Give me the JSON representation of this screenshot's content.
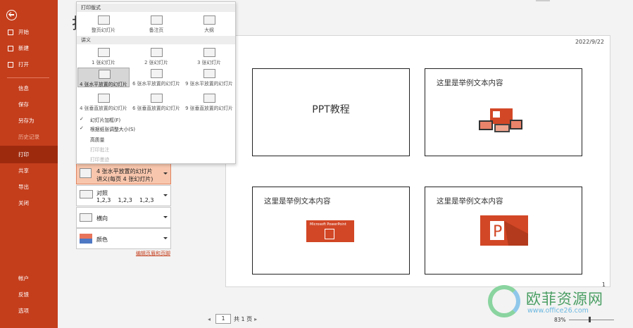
{
  "nav": {
    "items": [
      {
        "label": "开始",
        "icon": "home-icon"
      },
      {
        "label": "新建",
        "icon": "new-file-icon"
      },
      {
        "label": "打开",
        "icon": "folder-open-icon"
      },
      {
        "label": "信息"
      },
      {
        "label": "保存"
      },
      {
        "label": "另存为"
      },
      {
        "label": "历史记录"
      },
      {
        "label": "打印"
      },
      {
        "label": "共享"
      },
      {
        "label": "导出"
      },
      {
        "label": "关闭"
      },
      {
        "label": "帐户"
      },
      {
        "label": "反馈"
      },
      {
        "label": "选项"
      }
    ]
  },
  "title_glyph": "打",
  "dropdown": {
    "section_print_layout": "打印版式",
    "layouts": [
      "整页幻灯片",
      "备注页",
      "大纲"
    ],
    "section_handouts": "讲义",
    "handouts": [
      "1 张幻灯片",
      "2 张幻灯片",
      "3 张幻灯片",
      "4 张水平放置的幻灯片",
      "6 张水平放置的幻灯片",
      "9 张水平放置的幻灯片",
      "4 张垂直放置的幻灯片",
      "6 张垂直放置的幻灯片",
      "9 张垂直放置的幻灯片"
    ],
    "options": [
      {
        "label": "幻灯片加框(F)",
        "checked": "✓",
        "disabled": false
      },
      {
        "label": "根据纸张调整大小(S)",
        "checked": "✓",
        "disabled": false
      },
      {
        "label": "高质量",
        "checked": "",
        "disabled": false
      },
      {
        "label": "打印批注",
        "checked": "",
        "disabled": true
      },
      {
        "label": "打印墨迹",
        "checked": "",
        "disabled": true
      }
    ]
  },
  "settings": {
    "layout_line1": "4 张水平放置的幻灯片",
    "layout_line2": "讲义(每页 4 张幻灯片)",
    "collate_label": "对照",
    "collate_seq": "1,2,3    1,2,3    1,2,3",
    "orientation_label": "横向",
    "color_label": "颜色",
    "edit_header_footer": "编辑页眉和页脚"
  },
  "preview": {
    "date": "2022/9/22",
    "page_number": "1",
    "slides": [
      {
        "text": "PPT教程"
      },
      {
        "text": "这里是举例文本内容"
      },
      {
        "text": "这里是举例文本内容",
        "badge": "Microsoft PowerPoint"
      },
      {
        "text": "这里是举例文本内容"
      }
    ]
  },
  "pager": {
    "prev": "◂",
    "current": "1",
    "total": "共 1 页",
    "next": "▸"
  },
  "zoom": {
    "value": "83%"
  },
  "watermark": {
    "text": "欧菲资源网",
    "url": "www.office26.com"
  },
  "colors": {
    "accent": "#c43e1c",
    "selected_nav": "#9e2a0e",
    "ppt_red": "#d24726"
  }
}
